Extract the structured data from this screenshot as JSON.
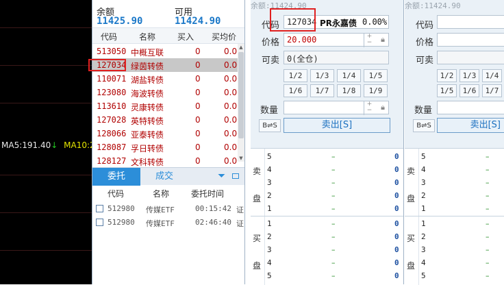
{
  "chart": {
    "ma5": "MA5:191.40",
    "ma5_arrow": "↓",
    "ma10": "MA10:2"
  },
  "balance": {
    "label1": "余额",
    "value1": "11425.90",
    "label2": "可用",
    "value2": "11424.90"
  },
  "positions": {
    "headers": [
      "代码",
      "名称",
      "买入",
      "买均价"
    ],
    "rows": [
      {
        "code": "513050",
        "name": "中概互联",
        "buy": "0",
        "avg": "0.00"
      },
      {
        "code": "127034",
        "name": "绿茵转债",
        "buy": "0",
        "avg": "0.00"
      },
      {
        "code": "110071",
        "name": "湖盐转债",
        "buy": "0",
        "avg": "0.00"
      },
      {
        "code": "123080",
        "name": "海波转债",
        "buy": "0",
        "avg": "0.00"
      },
      {
        "code": "113610",
        "name": "灵康转债",
        "buy": "0",
        "avg": "0.00"
      },
      {
        "code": "127028",
        "name": "英特转债",
        "buy": "0",
        "avg": "0.00"
      },
      {
        "code": "128066",
        "name": "亚泰转债",
        "buy": "0",
        "avg": "0.00"
      },
      {
        "code": "128087",
        "name": "孚日转债",
        "buy": "0",
        "avg": "0.00"
      },
      {
        "code": "128127",
        "name": "文科转债",
        "buy": "0",
        "avg": "0.00"
      }
    ]
  },
  "tabs": {
    "entrust": "委托",
    "deal": "成交"
  },
  "orders": {
    "headers": [
      "代码",
      "名称",
      "委托时间"
    ],
    "rows": [
      {
        "code": "512980",
        "name": "传媒ETF",
        "time": "00:15:42",
        "extra": "证"
      },
      {
        "code": "512980",
        "name": "传媒ETF",
        "time": "02:46:40",
        "extra": "证"
      }
    ]
  },
  "panel1": {
    "avail": "余额:11424.90",
    "code_label": "代码",
    "code_value": "127034",
    "stock_name": "PR永嘉债",
    "pct": "0.00%",
    "price_label": "价格",
    "price_value": "20.000",
    "sellable_label": "可卖",
    "sellable_value": "0(全仓)",
    "fractions": [
      "1/2",
      "1/3",
      "1/4",
      "1/5",
      "1/6",
      "1/7",
      "1/8",
      "1/9"
    ],
    "qty_label": "数量",
    "swap": "B⇌S",
    "sell_button": "卖出[S]"
  },
  "panel2": {
    "avail": "余额:11424.90",
    "code_label": "代码",
    "price_label": "价格",
    "sellable_label": "可卖",
    "fractions": [
      "1/2",
      "1/3",
      "1/4",
      "1/5",
      "1/6",
      "1/7"
    ],
    "qty_label": "数量",
    "swap": "B⇌S",
    "sell_button": "卖出[S]"
  },
  "orderbook": {
    "sell_label_1": "卖",
    "sell_label_2": "盘",
    "buy_label_1": "买",
    "buy_label_2": "盘",
    "sell_levels": [
      "5",
      "4",
      "3",
      "2",
      "1"
    ],
    "buy_levels": [
      "1",
      "2",
      "3",
      "4",
      "5"
    ],
    "dash": "–",
    "zero": "0"
  },
  "colors": {
    "accent": "#2c8ed9",
    "red": "#b00000",
    "highlight": "#e02020"
  }
}
